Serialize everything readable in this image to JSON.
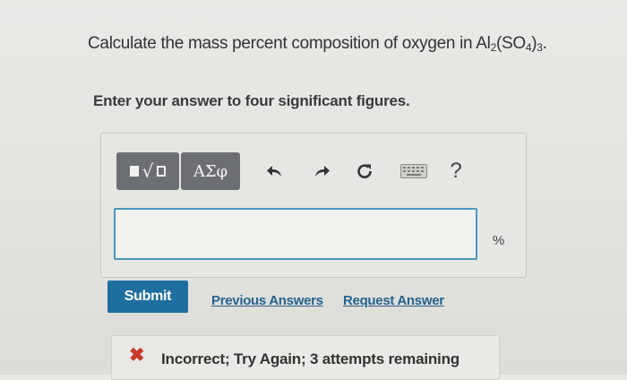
{
  "question": {
    "prefix": "Calculate the mass percent composition of oxygen in Al",
    "sub1": "2",
    "mid": "(SO",
    "sub2": "4",
    "close": ")",
    "sub3": "3",
    "end": "."
  },
  "instruction": "Enter your answer to four significant figures.",
  "toolbar": {
    "templates_icon": "templates-sqrt-icon",
    "greek_label": "ΑΣφ",
    "undo_icon": "undo-icon",
    "redo_icon": "redo-icon",
    "reset_icon": "reset-icon",
    "keyboard_icon": "keyboard-icon",
    "help_label": "?"
  },
  "answer": {
    "value": "",
    "unit": "%"
  },
  "actions": {
    "submit_label": "Submit",
    "previous_answers_label": "Previous Answers",
    "request_answer_label": "Request Answer"
  },
  "feedback": {
    "icon": "x-icon",
    "text": "Incorrect; Try Again; 3 attempts remaining"
  },
  "colors": {
    "submit": "#1e6e9f",
    "link": "#23638e",
    "input_border": "#4a98bf",
    "error": "#c63a2b",
    "toolbar_button": "#6b6e73"
  }
}
